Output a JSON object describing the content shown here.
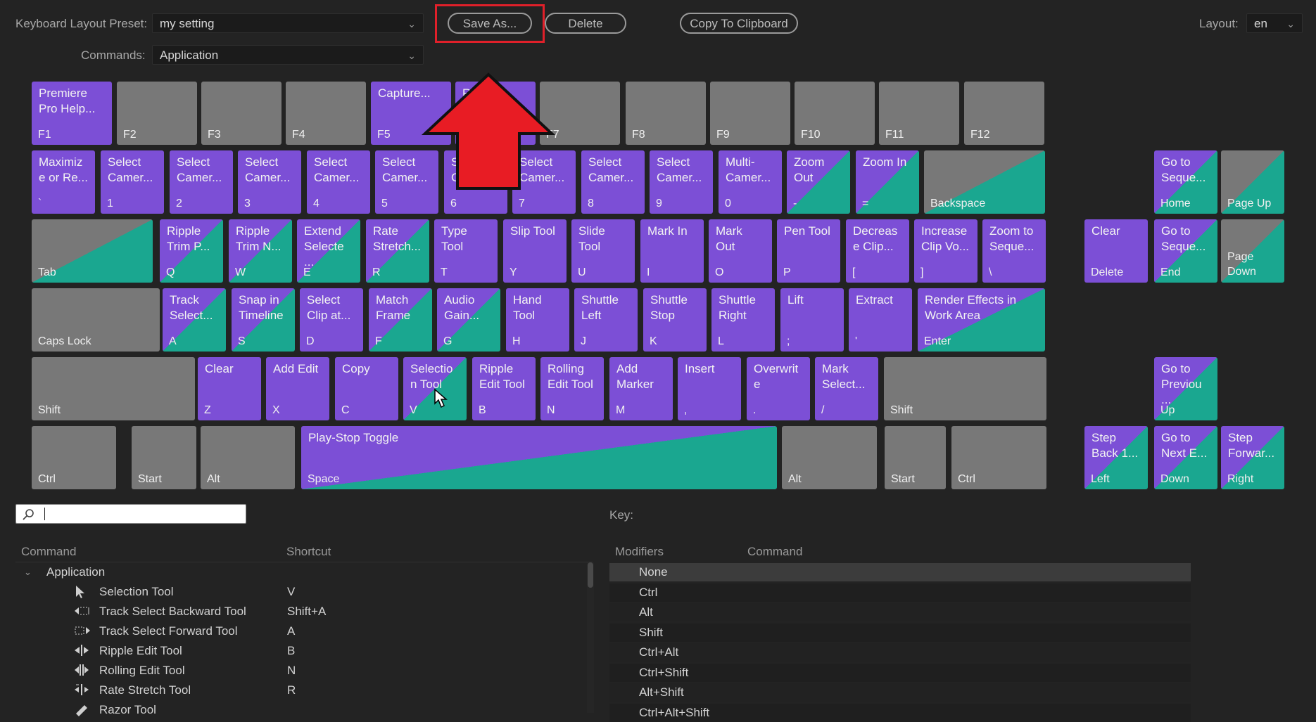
{
  "toolbar": {
    "preset_label": "Keyboard Layout Preset:",
    "preset_value": "my setting",
    "commands_label": "Commands:",
    "commands_value": "Application",
    "save_as": "Save As...",
    "delete": "Delete",
    "copy_clipboard": "Copy To Clipboard",
    "layout_label": "Layout:",
    "layout_value": "en"
  },
  "keyboard": {
    "row1": [
      {
        "cmd": "Premiere\nPro Help...",
        "key": "F1",
        "style": "p"
      },
      {
        "cmd": "",
        "key": "F2",
        "style": "g"
      },
      {
        "cmd": "",
        "key": "F3",
        "style": "g"
      },
      {
        "cmd": "",
        "key": "F4",
        "style": "g"
      },
      {
        "cmd": "Capture...",
        "key": "F5",
        "style": "p"
      },
      {
        "cmd": "R",
        "key": "F6",
        "style": "p"
      },
      {
        "cmd": "",
        "key": "F7",
        "style": "g"
      },
      {
        "cmd": "",
        "key": "F8",
        "style": "g"
      },
      {
        "cmd": "",
        "key": "F9",
        "style": "g"
      },
      {
        "cmd": "",
        "key": "F10",
        "style": "g"
      },
      {
        "cmd": "",
        "key": "F11",
        "style": "g"
      },
      {
        "cmd": "",
        "key": "F12",
        "style": "g"
      }
    ],
    "row2": [
      {
        "cmd": "Maximiz\ne or Re...",
        "key": "`",
        "style": "p"
      },
      {
        "cmd": "Select\nCamer...",
        "key": "1",
        "style": "p"
      },
      {
        "cmd": "Select\nCamer...",
        "key": "2",
        "style": "p"
      },
      {
        "cmd": "Select\nCamer...",
        "key": "3",
        "style": "p"
      },
      {
        "cmd": "Select\nCamer...",
        "key": "4",
        "style": "p"
      },
      {
        "cmd": "Select\nCamer...",
        "key": "5",
        "style": "p"
      },
      {
        "cmd": "S\nC",
        "key": "6",
        "style": "p"
      },
      {
        "cmd": "Select\nCamer...",
        "key": "7",
        "style": "p"
      },
      {
        "cmd": "Select\nCamer...",
        "key": "8",
        "style": "p"
      },
      {
        "cmd": "Select\nCamer...",
        "key": "9",
        "style": "p"
      },
      {
        "cmd": "Multi-\nCamer...",
        "key": "0",
        "style": "p"
      },
      {
        "cmd": "Zoom\nOut",
        "key": "-",
        "style": "m"
      },
      {
        "cmd": "Zoom In",
        "key": "=",
        "style": "m"
      },
      {
        "cmd": "",
        "key": "Backspace",
        "style": "mg"
      }
    ],
    "row3": [
      {
        "cmd": "",
        "key": "Tab",
        "style": "mg"
      },
      {
        "cmd": "Ripple\nTrim P...",
        "key": "Q",
        "style": "m"
      },
      {
        "cmd": "Ripple\nTrim N...",
        "key": "W",
        "style": "m"
      },
      {
        "cmd": "Extend\nSelecte\n...",
        "key": "E",
        "style": "m"
      },
      {
        "cmd": "Rate\nStretch...",
        "key": "R",
        "style": "m"
      },
      {
        "cmd": "Type\nTool",
        "key": "T",
        "style": "p"
      },
      {
        "cmd": "Slip Tool",
        "key": "Y",
        "style": "p"
      },
      {
        "cmd": "Slide\nTool",
        "key": "U",
        "style": "p"
      },
      {
        "cmd": "Mark In",
        "key": "I",
        "style": "p"
      },
      {
        "cmd": "Mark\nOut",
        "key": "O",
        "style": "p"
      },
      {
        "cmd": "Pen Tool",
        "key": "P",
        "style": "p"
      },
      {
        "cmd": "Decreas\ne Clip...",
        "key": "[",
        "style": "p"
      },
      {
        "cmd": "Increase\nClip Vo...",
        "key": "]",
        "style": "p"
      },
      {
        "cmd": "Zoom to\nSeque...",
        "key": "\\",
        "style": "p"
      }
    ],
    "row4": [
      {
        "cmd": "",
        "key": "Caps Lock",
        "style": "g"
      },
      {
        "cmd": "Track\nSelect...",
        "key": "A",
        "style": "m"
      },
      {
        "cmd": "Snap in\nTimeline",
        "key": "S",
        "style": "m"
      },
      {
        "cmd": "Select\nClip at...",
        "key": "D",
        "style": "p"
      },
      {
        "cmd": "Match\nFrame",
        "key": "F",
        "style": "m"
      },
      {
        "cmd": "Audio\nGain...",
        "key": "G",
        "style": "m"
      },
      {
        "cmd": "Hand\nTool",
        "key": "H",
        "style": "p"
      },
      {
        "cmd": "Shuttle\nLeft",
        "key": "J",
        "style": "p"
      },
      {
        "cmd": "Shuttle\nStop",
        "key": "K",
        "style": "p"
      },
      {
        "cmd": "Shuttle\nRight",
        "key": "L",
        "style": "p"
      },
      {
        "cmd": "Lift",
        "key": ";",
        "style": "p"
      },
      {
        "cmd": "Extract",
        "key": "'",
        "style": "p"
      },
      {
        "cmd": "Render Effects in\nWork Area",
        "key": "Enter",
        "style": "m"
      }
    ],
    "row5": [
      {
        "cmd": "",
        "key": "Shift",
        "style": "g"
      },
      {
        "cmd": "Clear",
        "key": "Z",
        "style": "p"
      },
      {
        "cmd": "Add Edit",
        "key": "X",
        "style": "p"
      },
      {
        "cmd": "Copy",
        "key": "C",
        "style": "p"
      },
      {
        "cmd": "Selectio\nn Tool",
        "key": "V",
        "style": "m"
      },
      {
        "cmd": "Ripple\nEdit Tool",
        "key": "B",
        "style": "p"
      },
      {
        "cmd": "Rolling\nEdit Tool",
        "key": "N",
        "style": "p"
      },
      {
        "cmd": "Add\nMarker",
        "key": "M",
        "style": "p"
      },
      {
        "cmd": "Insert",
        "key": ",",
        "style": "p"
      },
      {
        "cmd": "Overwrit\ne",
        "key": ".",
        "style": "p"
      },
      {
        "cmd": "Mark\nSelect...",
        "key": "/",
        "style": "p"
      },
      {
        "cmd": "",
        "key": "Shift",
        "style": "g"
      }
    ],
    "row6": [
      {
        "cmd": "",
        "key": "Ctrl",
        "style": "g"
      },
      {
        "cmd": "",
        "key": "Start",
        "style": "g"
      },
      {
        "cmd": "",
        "key": "Alt",
        "style": "g"
      },
      {
        "cmd": "Play-Stop Toggle",
        "key": "Space",
        "style": "m"
      },
      {
        "cmd": "",
        "key": "Alt",
        "style": "g"
      },
      {
        "cmd": "",
        "key": "Start",
        "style": "g"
      },
      {
        "cmd": "",
        "key": "Ctrl",
        "style": "g"
      }
    ],
    "nav": [
      {
        "cmd": "Go to\nSeque...",
        "key": "Home",
        "style": "m"
      },
      {
        "cmd": "",
        "key": "Page Up",
        "style": "mg"
      },
      {
        "cmd": "Clear",
        "key": "Delete",
        "style": "p"
      },
      {
        "cmd": "Go to\nSeque...",
        "key": "End",
        "style": "m"
      },
      {
        "cmd": "",
        "key": "Page\nDown",
        "style": "mg"
      },
      {
        "cmd": "Go to\nPreviou\n...",
        "key": "Up",
        "style": "m"
      },
      {
        "cmd": "Step\nBack 1...",
        "key": "Left",
        "style": "m"
      },
      {
        "cmd": "Go to\nNext E...",
        "key": "Down",
        "style": "m"
      },
      {
        "cmd": "Step\nForwar...",
        "key": "Right",
        "style": "m"
      }
    ]
  },
  "search": {
    "placeholder": ""
  },
  "key_label": "Key:",
  "commands_table": {
    "headers": [
      "Command",
      "Shortcut"
    ],
    "group": "Application",
    "rows": [
      {
        "name": "Selection Tool",
        "shortcut": "V",
        "icon": "selection-arrow-icon"
      },
      {
        "name": "Track Select Backward Tool",
        "shortcut": "Shift+A",
        "icon": "track-select-backward-icon"
      },
      {
        "name": "Track Select Forward Tool",
        "shortcut": "A",
        "icon": "track-select-forward-icon"
      },
      {
        "name": "Ripple Edit Tool",
        "shortcut": "B",
        "icon": "ripple-edit-icon"
      },
      {
        "name": "Rolling Edit Tool",
        "shortcut": "N",
        "icon": "rolling-edit-icon"
      },
      {
        "name": "Rate Stretch Tool",
        "shortcut": "R",
        "icon": "rate-stretch-icon"
      },
      {
        "name": "Razor Tool",
        "shortcut": "",
        "icon": "razor-icon"
      }
    ]
  },
  "modifiers_table": {
    "headers": [
      "Modifiers",
      "Command"
    ],
    "rows": [
      "None",
      "Ctrl",
      "Alt",
      "Shift",
      "Ctrl+Alt",
      "Ctrl+Shift",
      "Alt+Shift",
      "Ctrl+Alt+Shift"
    ]
  },
  "colors": {
    "purple": "#7c4fd6",
    "teal": "#1aa790",
    "gray_key": "#787878",
    "highlight": "#e0202a"
  }
}
